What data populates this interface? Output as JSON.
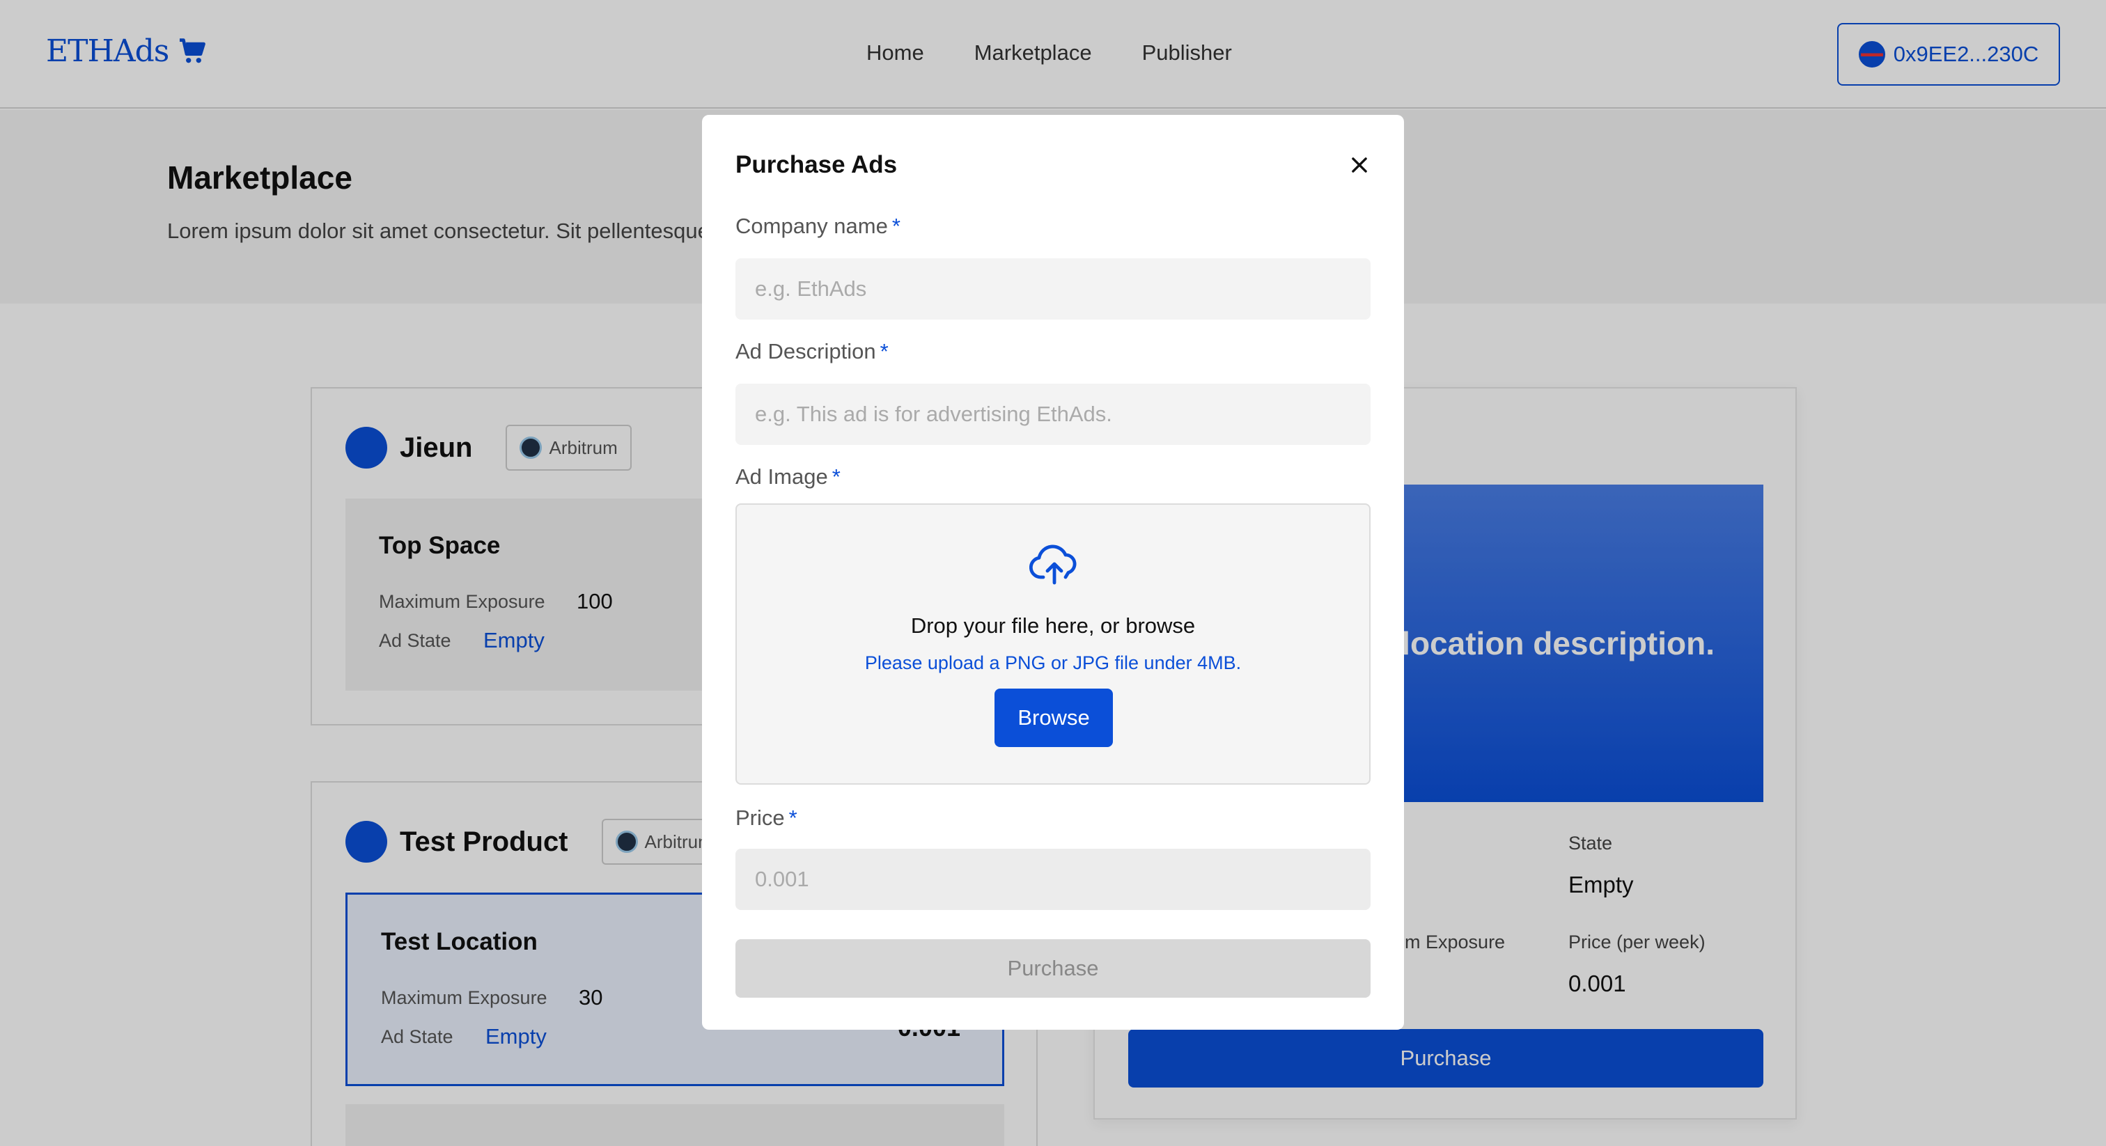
{
  "header": {
    "logo_text": "ETHAds",
    "nav": [
      "Home",
      "Marketplace",
      "Publisher"
    ],
    "wallet_address": "0x9EE2...230C"
  },
  "hero": {
    "title": "Marketplace",
    "description": "Lorem ipsum dolor sit amet consectetur. Sit pellentesque aliquet tincidunt vitae. Quis lectus ac bibendum quis ac felis fermentum."
  },
  "listings": [
    {
      "seller": "Jieun",
      "chain": "Arbitrum",
      "slots": [
        {
          "title": "Top Space",
          "max_exposure_label": "Maximum Exposure",
          "max_exposure": "100",
          "state_label": "Ad State",
          "state": "Empty",
          "price": ""
        }
      ]
    },
    {
      "seller": "Test Product",
      "chain": "Arbitrum",
      "slots": [
        {
          "title": "Test Location",
          "max_exposure_label": "Maximum Exposure",
          "max_exposure": "30",
          "state_label": "Ad State",
          "state": "Empty",
          "price": "0.001"
        }
      ]
    }
  ],
  "preview": {
    "banner_text": "location description.",
    "state_label": "State",
    "state_value": "Empty",
    "exposure_label": "um Exposure",
    "price_label": "Price (per week)",
    "price_value": "0.001",
    "purchase_label": "Purchase"
  },
  "modal": {
    "title": "Purchase Ads",
    "company_label": "Company name",
    "company_placeholder": "e.g. EthAds",
    "desc_label": "Ad Description",
    "desc_placeholder": "e.g. This ad is for advertising EthAds.",
    "image_label": "Ad Image",
    "drop_text": "Drop your file here, or browse",
    "drop_hint": "Please upload a PNG or JPG file under 4MB.",
    "browse_label": "Browse",
    "price_label": "Price",
    "price_placeholder": "0.001",
    "purchase_label": "Purchase",
    "required_mark": "*"
  },
  "colors": {
    "accent": "#0b4fd8"
  },
  "icons": {
    "cart": "cart-icon",
    "close": "close-icon",
    "upload": "cloud-upload-icon",
    "chain": "arbitrum-icon"
  }
}
